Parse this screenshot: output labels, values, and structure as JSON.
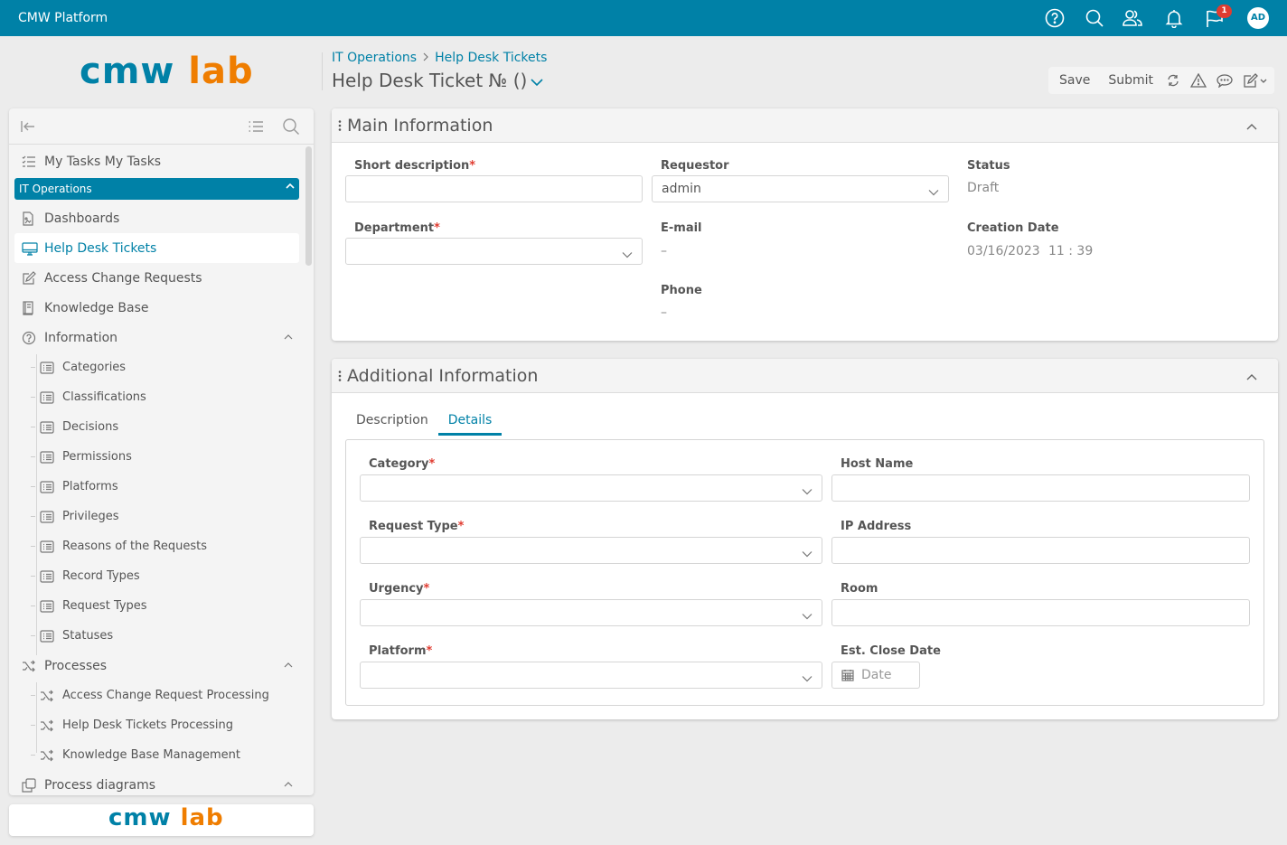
{
  "topbar": {
    "app_title": "CMW Platform",
    "icons": [
      "help-icon",
      "search-icon",
      "users-icon",
      "bell-icon",
      "flag-icon"
    ],
    "notification_count": "1",
    "avatar_initials": "AD"
  },
  "logo": {
    "part1": "cmw",
    "part2": "lab"
  },
  "breadcrumb": {
    "items": [
      "IT Operations",
      "Help Desk Tickets"
    ],
    "separator": ">"
  },
  "page": {
    "title": "Help Desk Ticket № ()"
  },
  "toolbar": {
    "save_label": "Save",
    "submit_label": "Submit",
    "icons": [
      "refresh-icon",
      "warning-icon",
      "comment-icon",
      "edit-icon"
    ]
  },
  "sidebar": {
    "top_item": "My Tasks My Tasks",
    "group": "IT Operations",
    "items": [
      {
        "label": "Dashboards",
        "icon": "dashboard-icon"
      },
      {
        "label": "Help Desk Tickets",
        "icon": "monitor-icon",
        "active": true
      },
      {
        "label": "Access Change Requests",
        "icon": "edit-icon"
      },
      {
        "label": "Knowledge Base",
        "icon": "book-icon"
      },
      {
        "label": "Information",
        "icon": "help-icon",
        "expanded": true
      }
    ],
    "information_children": [
      "Categories",
      "Classifications",
      "Decisions",
      "Permissions",
      "Platforms",
      "Privileges",
      "Reasons of the Requests",
      "Record Types",
      "Request Types",
      "Statuses"
    ],
    "processes": {
      "label": "Processes",
      "children": [
        "Access Change Request Processing",
        "Help Desk Tickets Processing",
        "Knowledge Base Management"
      ]
    },
    "process_diagrams": "Process diagrams"
  },
  "main_info": {
    "title": "Main Information",
    "short_description": {
      "label": "Short description",
      "value": ""
    },
    "department": {
      "label": "Department",
      "value": ""
    },
    "requestor": {
      "label": "Requestor",
      "value": "admin"
    },
    "email": {
      "label": "E-mail",
      "value": "–"
    },
    "phone": {
      "label": "Phone",
      "value": "–"
    },
    "status": {
      "label": "Status",
      "value": "Draft"
    },
    "creation_date": {
      "label": "Creation Date",
      "date": "03/16/2023",
      "time": "11 : 39"
    }
  },
  "additional_info": {
    "title": "Additional Information",
    "tabs": [
      "Description",
      "Details"
    ],
    "active_tab": "Details",
    "category": {
      "label": "Category",
      "value": ""
    },
    "request_type": {
      "label": "Request Type",
      "value": ""
    },
    "urgency": {
      "label": "Urgency",
      "value": ""
    },
    "platform": {
      "label": "Platform",
      "value": ""
    },
    "host_name": {
      "label": "Host Name",
      "value": ""
    },
    "ip_address": {
      "label": "IP Address",
      "value": ""
    },
    "room": {
      "label": "Room",
      "value": ""
    },
    "est_close_date": {
      "label": "Est. Close Date",
      "placeholder": "Date"
    }
  },
  "colors": {
    "brand": "#0081a7",
    "accent": "#ef7d00",
    "required": "#e03c31"
  }
}
